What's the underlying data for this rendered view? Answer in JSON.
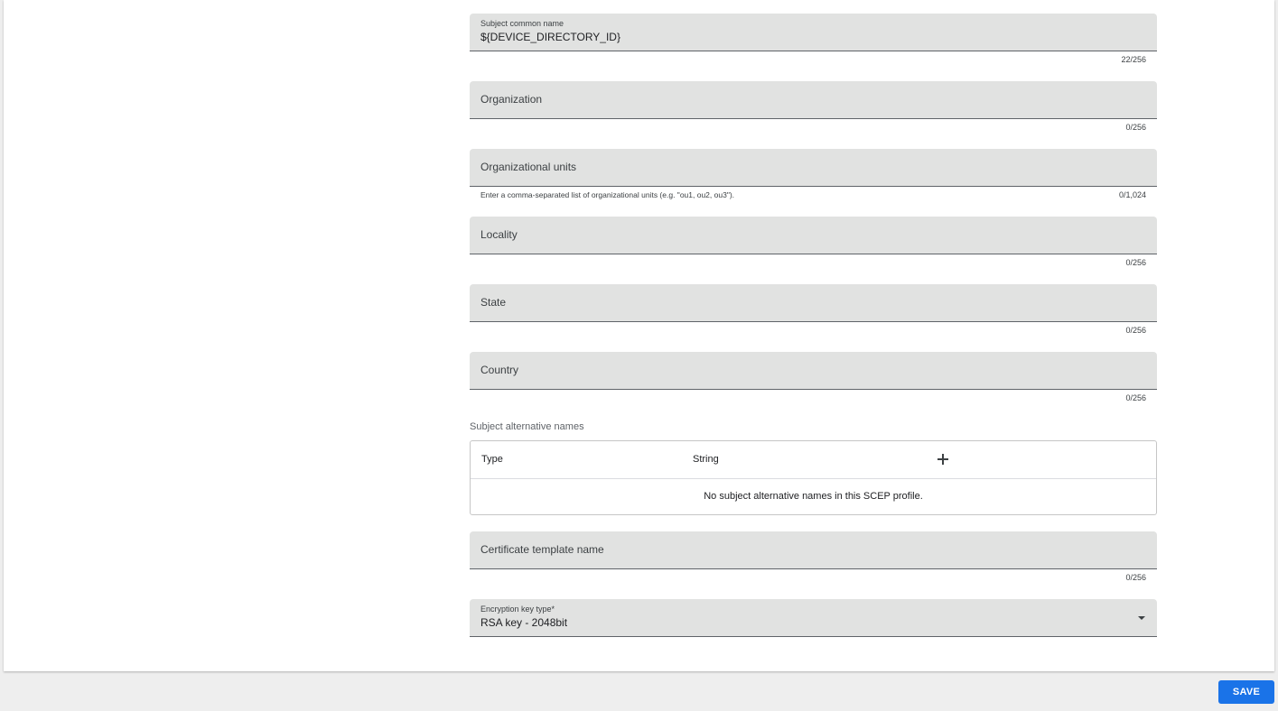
{
  "form": {
    "subject_common_name": {
      "label": "Subject common name",
      "value": "${DEVICE_DIRECTORY_ID}",
      "counter": "22/256"
    },
    "organization": {
      "label": "Organization",
      "counter": "0/256"
    },
    "organizational_units": {
      "label": "Organizational units",
      "hint": "Enter a comma-separated list of organizational units (e.g. \"ou1, ou2, ou3\").",
      "counter": "0/1,024"
    },
    "locality": {
      "label": "Locality",
      "counter": "0/256"
    },
    "state": {
      "label": "State",
      "counter": "0/256"
    },
    "country": {
      "label": "Country",
      "counter": "0/256"
    },
    "subject_alternative_names": {
      "label": "Subject alternative names",
      "columns": [
        "Type",
        "String"
      ],
      "add_icon": "plus-icon",
      "empty_message": "No subject alternative names in this SCEP profile."
    },
    "certificate_template_name": {
      "label": "Certificate template name",
      "counter": "0/256"
    },
    "encryption_key_type": {
      "label": "Encryption key type*",
      "selected": "RSA key - 2048bit",
      "icon": "dropdown-arrow-icon"
    }
  },
  "footer": {
    "save_label": "SAVE"
  },
  "colors": {
    "accent": "#1a73e8",
    "field_background": "#e1e2e1",
    "page_background": "#eeeeee"
  }
}
